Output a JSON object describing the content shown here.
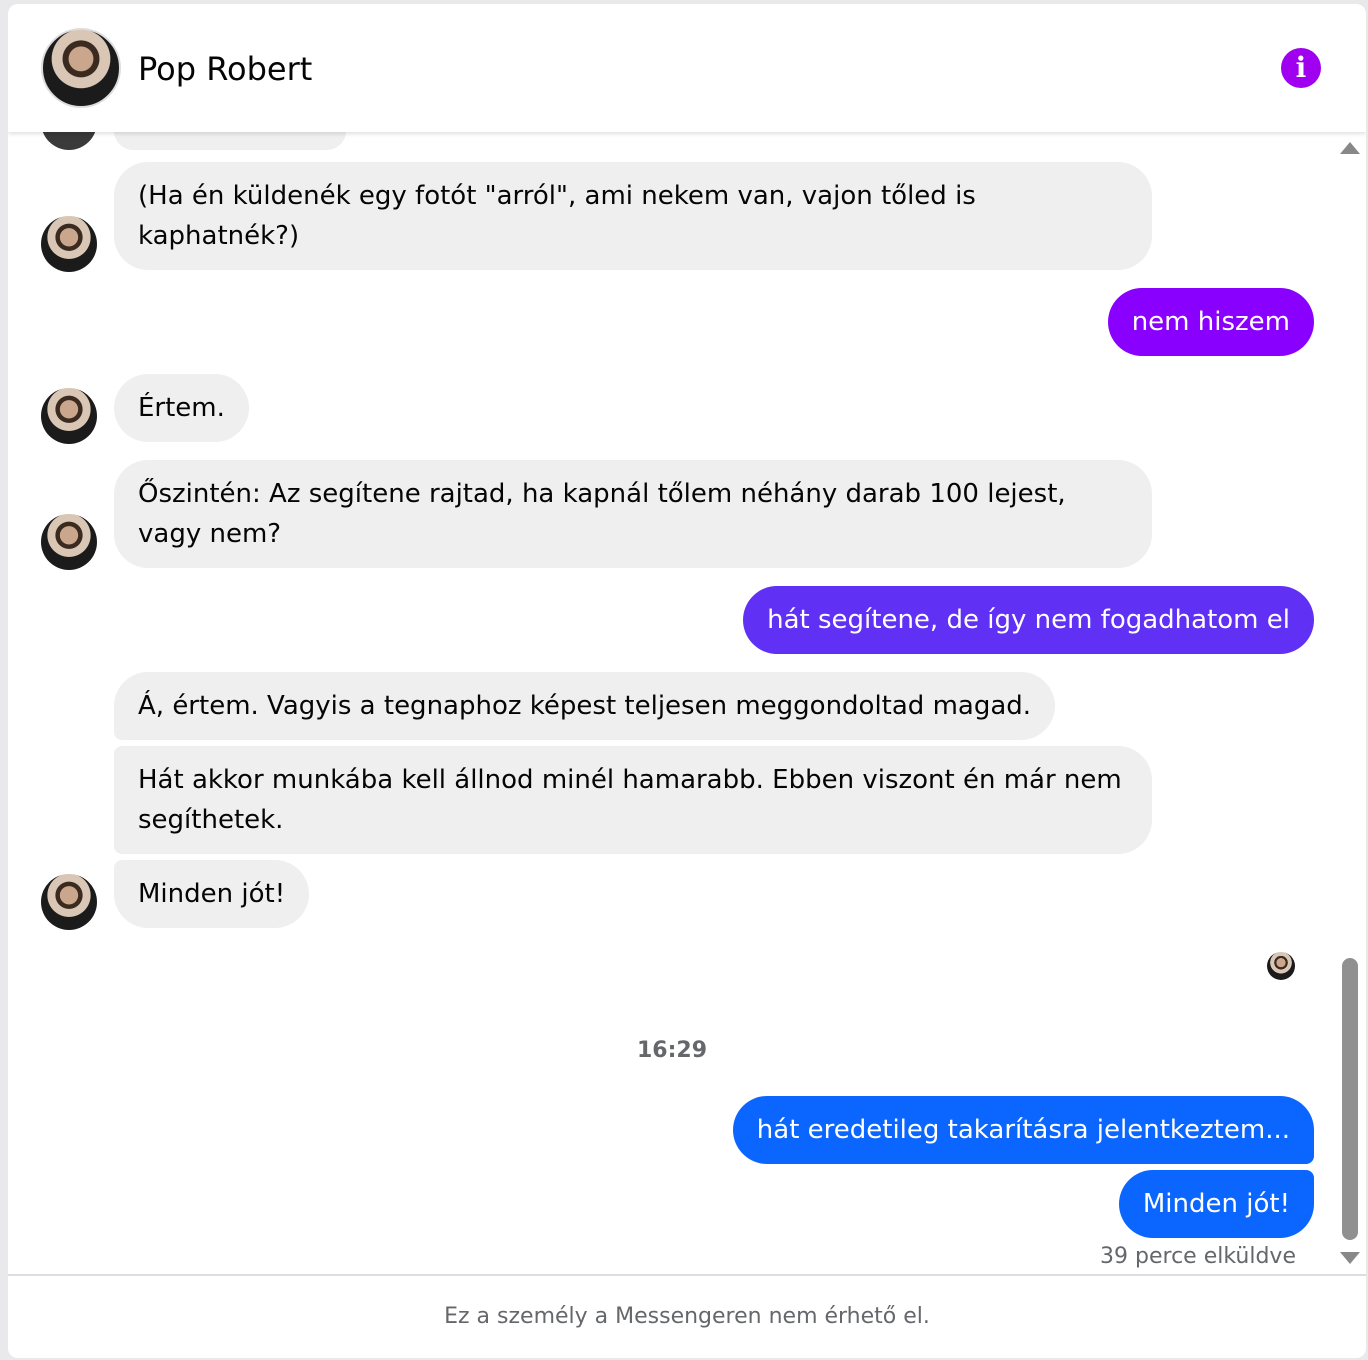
{
  "header": {
    "contact_name": "Pop Robert",
    "info_icon": "info-icon"
  },
  "messages": [
    {
      "from": "them",
      "text": "(Ha én küldenék egy fotót \"arról\", ami nekem van,  vajon tőled is kaphatnék?)"
    },
    {
      "from": "me",
      "text": "nem hiszem",
      "color": "#8a00ff"
    },
    {
      "from": "them",
      "text": "Értem."
    },
    {
      "from": "them",
      "text": "Őszintén: Az segítene rajtad, ha kapnál tőlem néhány darab 100 lejest, vagy nem?"
    },
    {
      "from": "me",
      "text": "hát segítene, de így nem fogadhatom el",
      "color": "#6030f5"
    },
    {
      "from": "them",
      "text": "Á, értem. Vagyis a tegnaphoz képest teljesen meggondoltad magad."
    },
    {
      "from": "them",
      "text": "Hát akkor munkába kell állnod minél hamarabb. Ebben viszont én már nem segíthetek."
    },
    {
      "from": "them",
      "text": "Minden jót!"
    },
    {
      "from": "me",
      "text": "hát eredetileg takarításra jelentkeztem...",
      "color": "#0a66ff"
    },
    {
      "from": "me",
      "text": "Minden jót!",
      "color": "#0a66ff"
    }
  ],
  "timestamp": "16:29",
  "sent_status": "39 perce elküldve",
  "footer": {
    "notice": "Ez a személy a Messengeren nem érhető el."
  }
}
